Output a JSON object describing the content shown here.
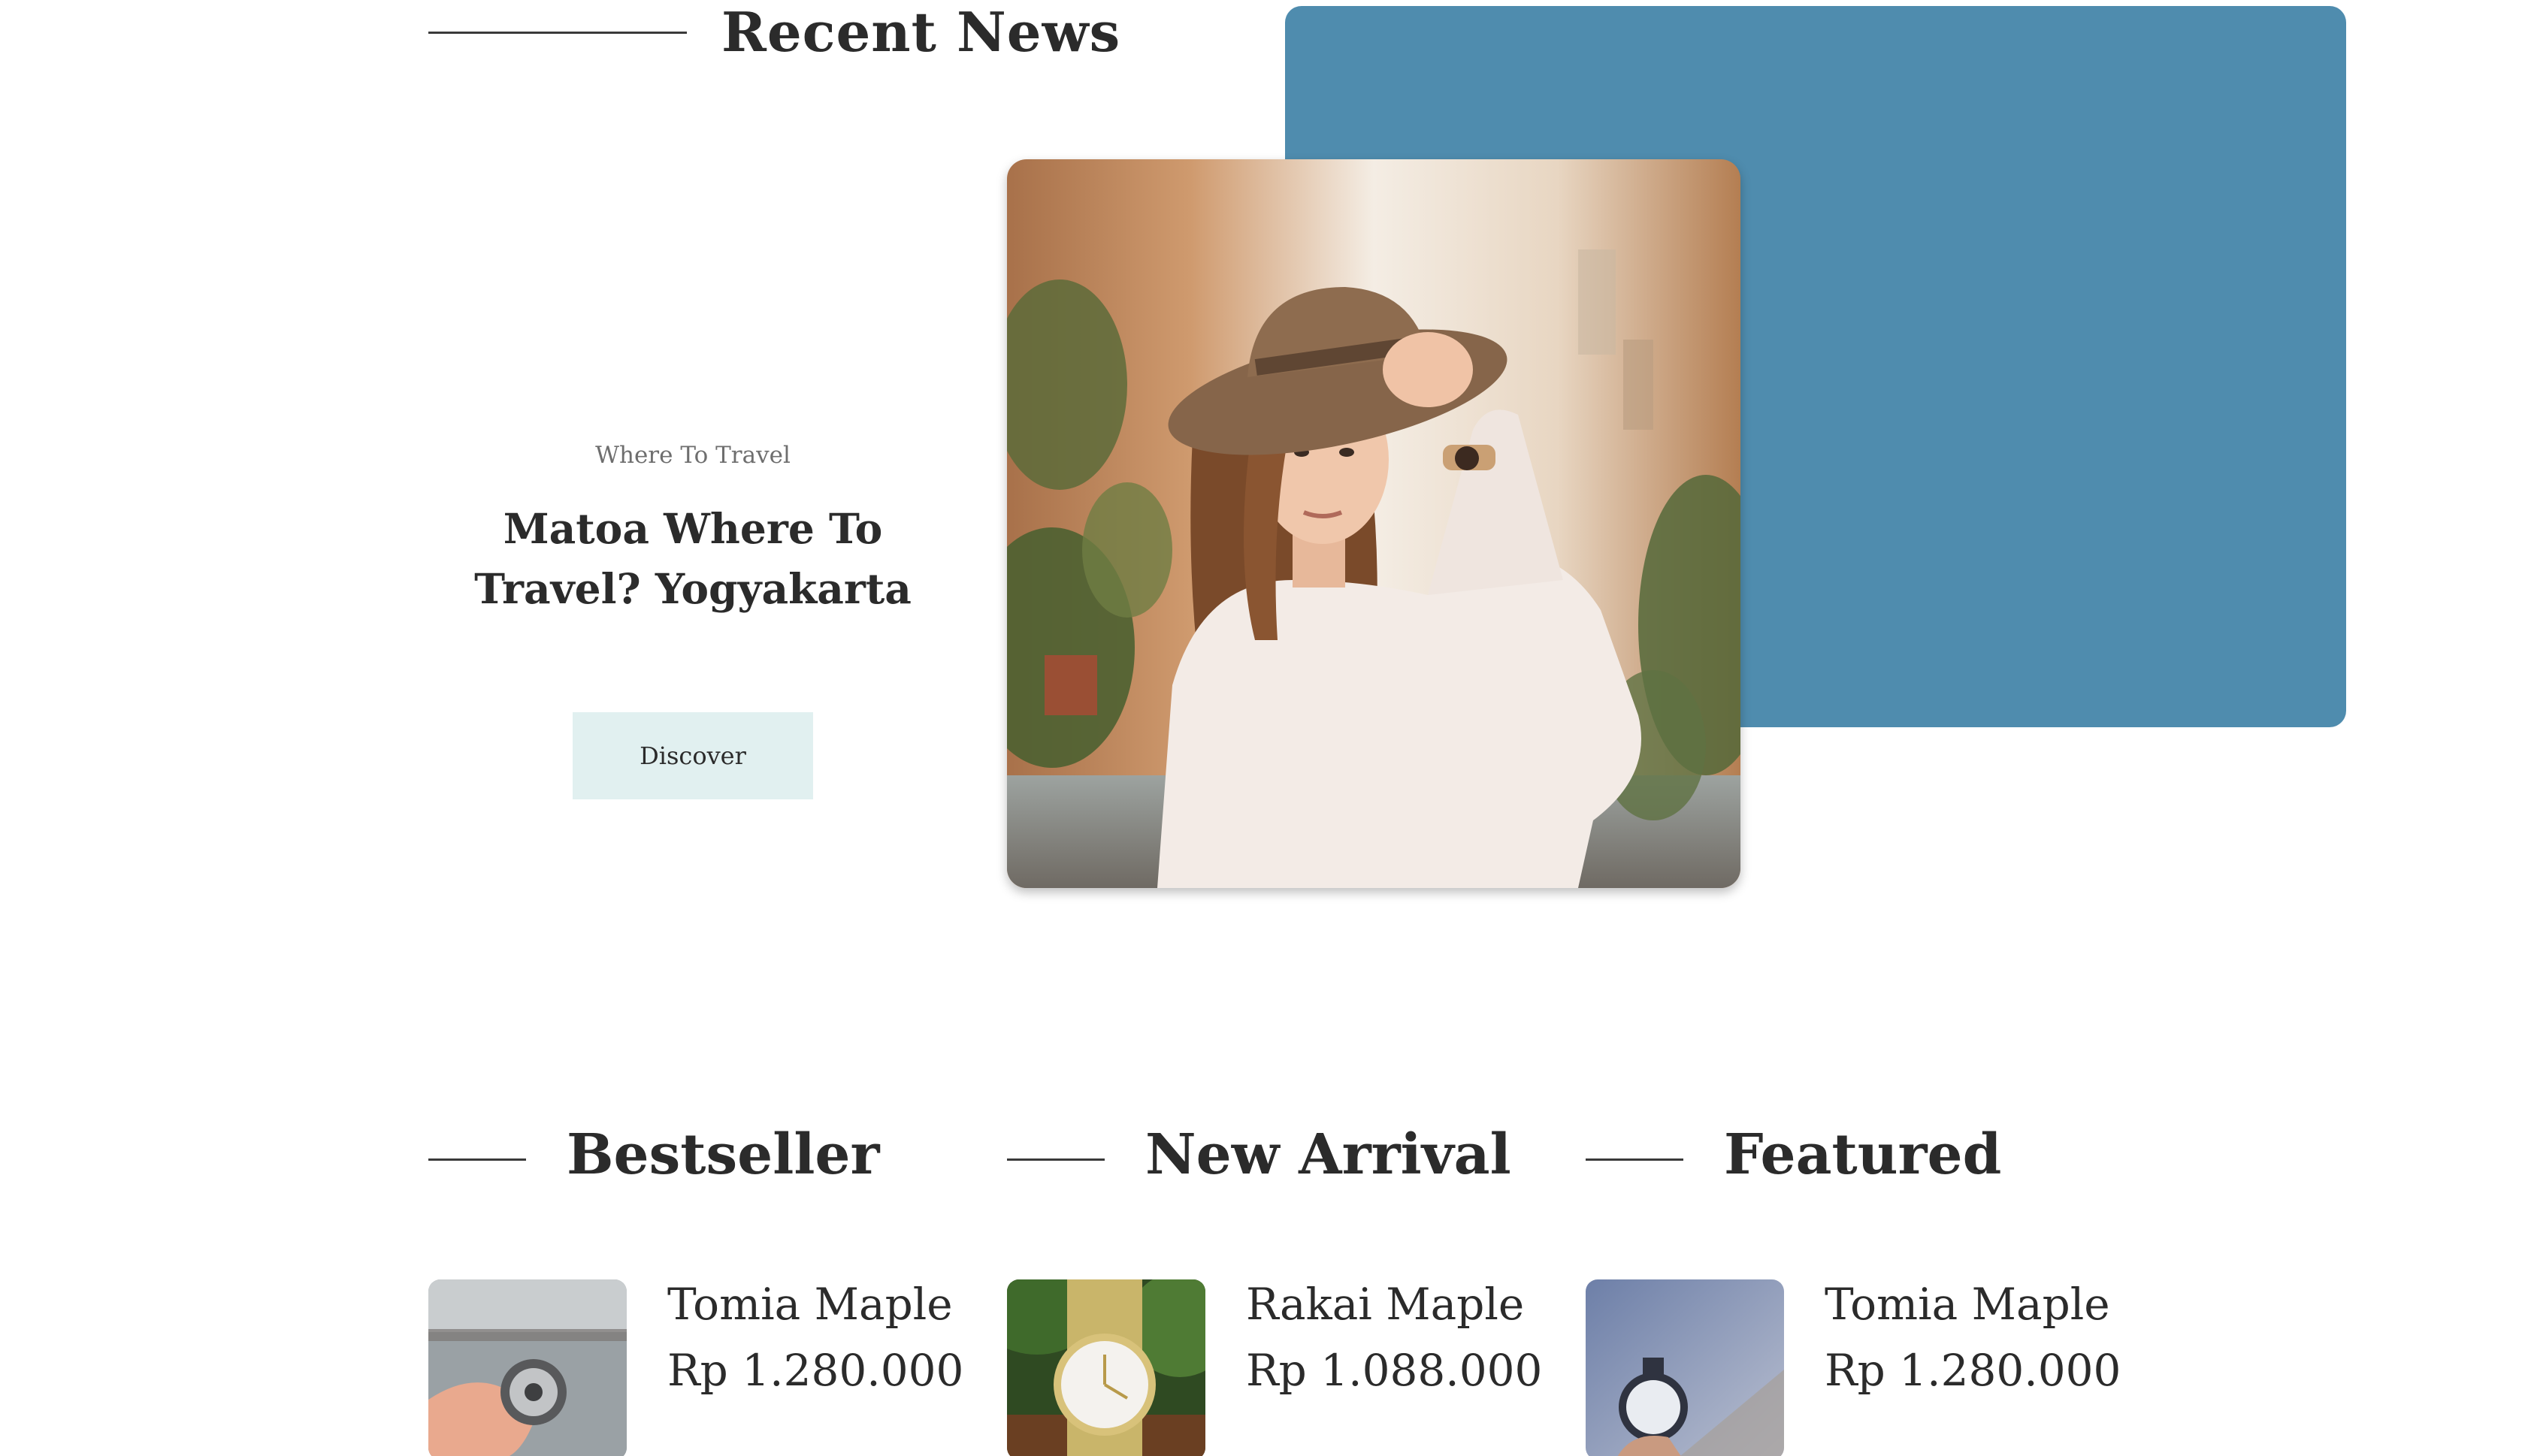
{
  "recent_news": {
    "heading": "Recent News",
    "category": "Where To Travel",
    "title": "Matoa Where To Travel? Yogyakarta",
    "discover_label": "Discover"
  },
  "colors": {
    "accent_blue": "#4f8cae",
    "button_bg": "#e1f0f0",
    "text": "#2b2b2b"
  },
  "sections": [
    {
      "heading": "Bestseller",
      "product": {
        "name": "Tomia Maple",
        "price": "Rp 1.280.000",
        "image": "hand-holding-watch-lake"
      }
    },
    {
      "heading": "New Arrival",
      "product": {
        "name": "Rakai Maple",
        "price": "Rp 1.088.000",
        "image": "gold-mesh-watch"
      }
    },
    {
      "heading": "Featured",
      "product": {
        "name": "Tomia Maple",
        "price": "Rp 1.280.000",
        "image": "hand-holding-dark-watch"
      }
    }
  ]
}
